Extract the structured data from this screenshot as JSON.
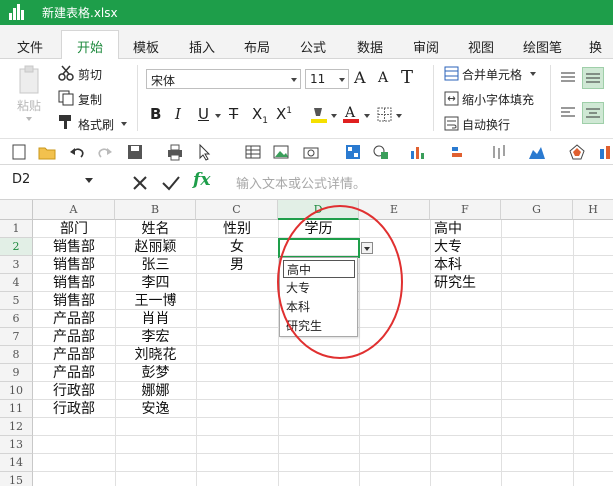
{
  "window": {
    "title": "新建表格.xlsx"
  },
  "tabs": [
    "文件",
    "开始",
    "模板",
    "插入",
    "布局",
    "公式",
    "数据",
    "审阅",
    "视图",
    "绘图笔",
    "换班"
  ],
  "active_tab": "开始",
  "ribbon": {
    "paste": "粘贴",
    "cut": "剪切",
    "copy": "复制",
    "format_painter": "格式刷",
    "font_name": "宋体",
    "font_size": "11",
    "merge_cells": "合并单元格",
    "shrink_to_fit": "缩小字体填充",
    "wrap_text": "自动换行"
  },
  "formula_bar": {
    "cell_ref": "D2",
    "placeholder": "输入文本或公式详情。",
    "fx": "fx"
  },
  "columns": [
    "A",
    "B",
    "C",
    "D",
    "E",
    "F",
    "G",
    "H"
  ],
  "selected_column": "D",
  "rows": [
    "1",
    "2",
    "3",
    "4",
    "5",
    "6",
    "7",
    "8",
    "9",
    "10",
    "11",
    "12",
    "13",
    "14",
    "15"
  ],
  "selected_row": "2",
  "cells": {
    "A": [
      "部门",
      "销售部",
      "销售部",
      "销售部",
      "销售部",
      "产品部",
      "产品部",
      "产品部",
      "产品部",
      "行政部",
      "行政部"
    ],
    "B": [
      "姓名",
      "赵丽颖",
      "张三",
      "李四",
      "王一博",
      "肖肖",
      "李宏",
      "刘晓花",
      "彭梦",
      "娜娜",
      "安逸"
    ],
    "C": [
      "性别",
      "女",
      "男"
    ],
    "D": [
      "学历"
    ],
    "F": [
      "高中",
      "大专",
      "本科",
      "研究生"
    ]
  },
  "dropdown": {
    "options": [
      "高中",
      "大专",
      "本科",
      "研究生"
    ],
    "highlighted": "高中"
  },
  "colors": {
    "accent": "#1e9e4a",
    "annotation": "#e03030"
  }
}
